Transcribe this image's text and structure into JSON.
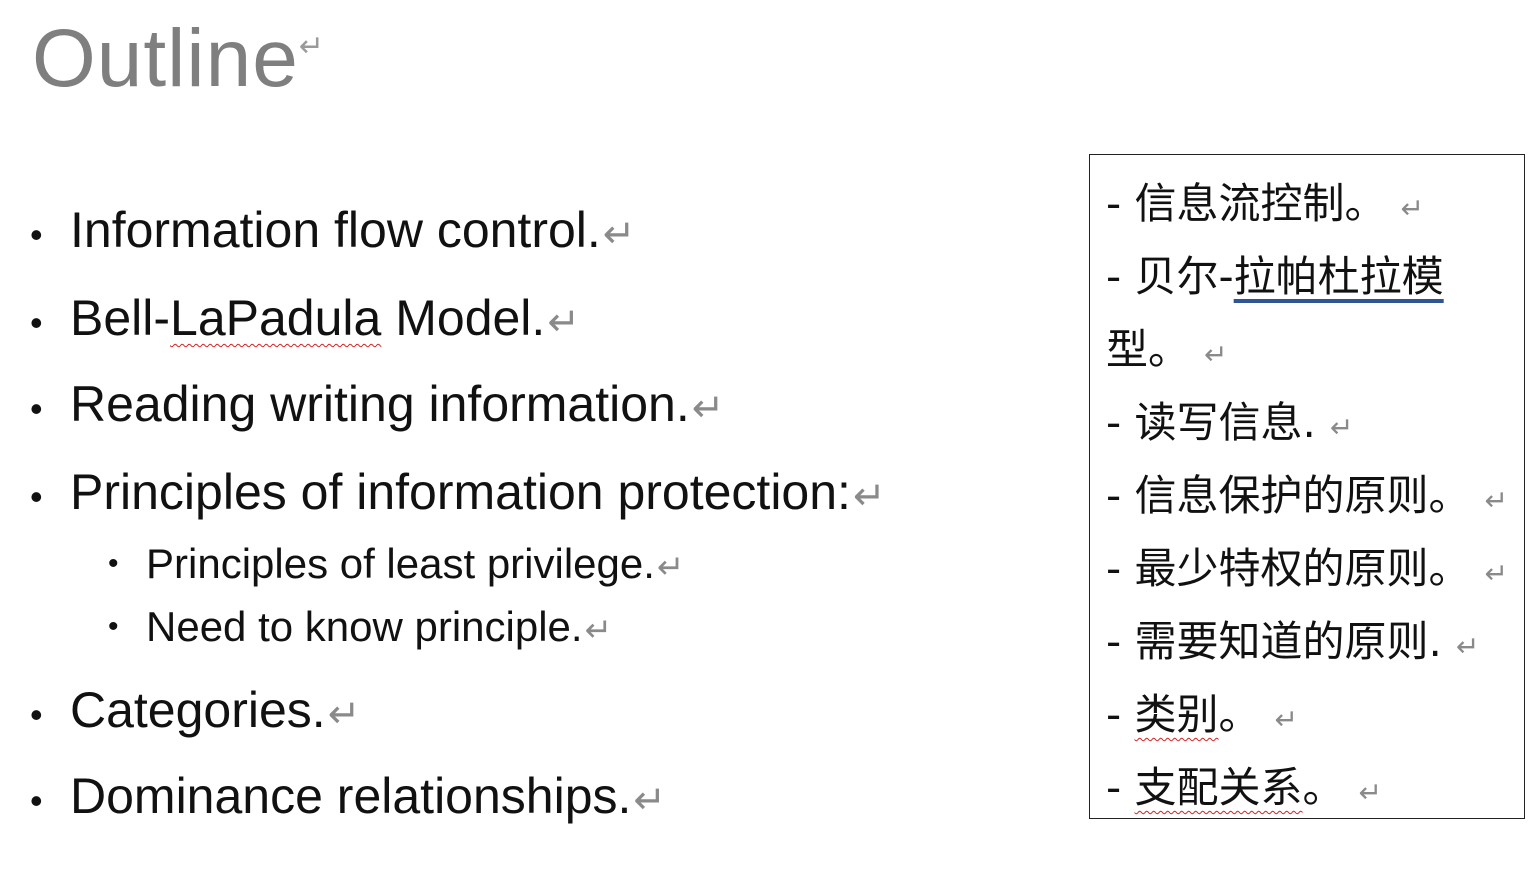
{
  "slide": {
    "title": "Outline",
    "title_mark": "↵"
  },
  "outline": {
    "items": [
      {
        "text": "Information flow control.",
        "mark": "↵"
      },
      {
        "text_prefix": "Bell-",
        "text_spell": "LaPadula",
        "text_suffix": " Model.",
        "mark": "↵"
      },
      {
        "text": "Reading writing information.",
        "mark": "↵"
      },
      {
        "text": "Principles of information protection:",
        "mark": "↵"
      },
      {
        "text": "Principles of least privilege.",
        "mark": "↵"
      },
      {
        "text": "Need to know principle.",
        "mark": "↵"
      },
      {
        "text": "Categories.",
        "mark": "↵"
      },
      {
        "text": "Dominance relationships.",
        "mark": "↵"
      }
    ]
  },
  "translation_box": {
    "lines": [
      {
        "text": "- 信息流控制。",
        "mark": "↵"
      },
      {
        "text_prefix": "- 贝尔-",
        "text_link": "拉帕杜拉模"
      },
      {
        "text": "型。",
        "mark": "↵"
      },
      {
        "text": "- 读写信息.",
        "mark": "↵"
      },
      {
        "text": "- 信息保护的原则。",
        "mark": "↵"
      },
      {
        "text": "- 最少特权的原则。",
        "mark": "↵"
      },
      {
        "text": "- 需要知道的原则.",
        "mark": "↵"
      },
      {
        "text_prefix": "- ",
        "text_spell": "类别",
        "text_suffix": "。",
        "mark": "↵"
      },
      {
        "text_prefix": "- ",
        "text_spell": "支配关系",
        "text_suffix": "。",
        "mark": "↵"
      }
    ]
  }
}
